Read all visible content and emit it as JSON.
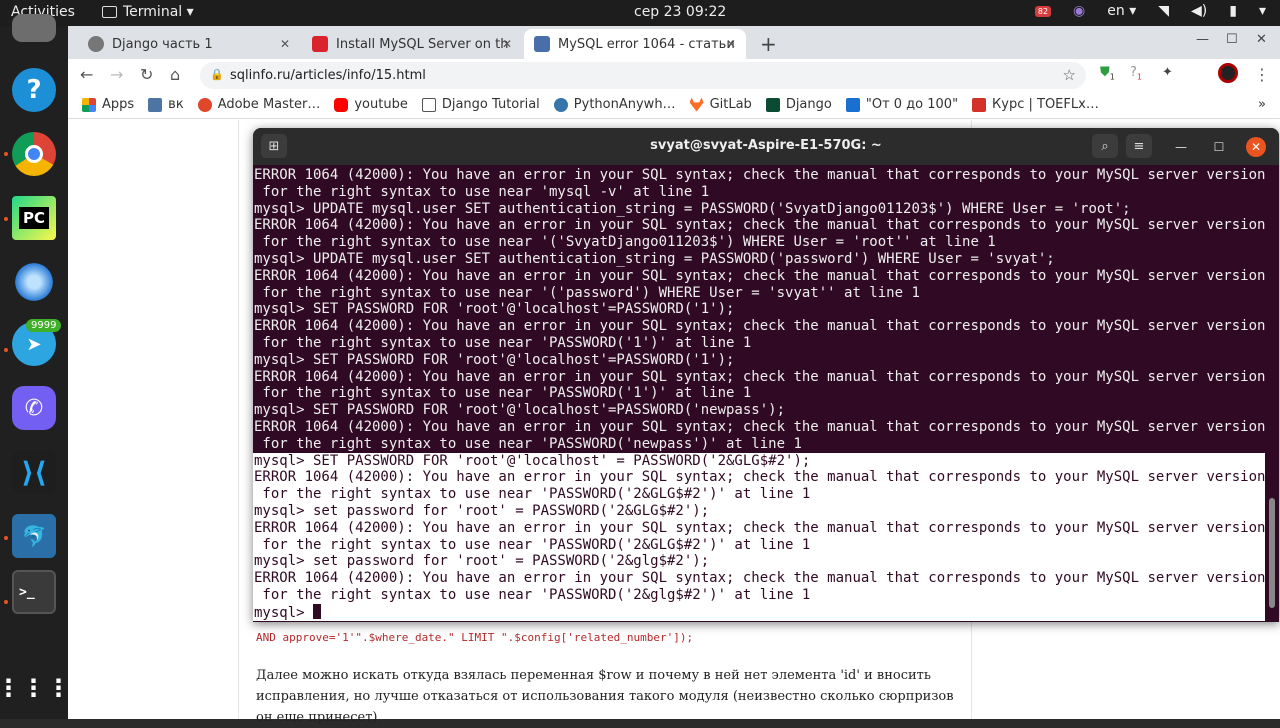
{
  "topbar": {
    "activities": "Activities",
    "app_menu": "Terminal ▾",
    "clock": "сер 23  09:22",
    "lang": "en ▾",
    "notif_count": "82"
  },
  "dock": {
    "telegram_badge": "9999",
    "pycharm_label": "PC",
    "help_label": "?"
  },
  "browser": {
    "tabs": [
      {
        "label": "Django часть 1"
      },
      {
        "label": "Install MySQL Server on th"
      },
      {
        "label": "MySQL error 1064 - статьи"
      }
    ],
    "url": "sqlinfo.ru/articles/info/15.html",
    "bookmarks": [
      "Apps",
      "вк",
      "Adobe Master…",
      "youtube",
      "Django Tutorial",
      "PythonAnywh…",
      "GitLab",
      "Django",
      "\"От 0 до 100\"",
      "Курс | TOEFLx…"
    ],
    "ext_badge_1": "1",
    "ext_badge_2": "1"
  },
  "page": {
    "code_line": "AND approve='1'\".$where_date.\" LIMIT \".$config['related_number']);",
    "paragraph": "Далее можно искать откуда взялась переменная $row и почему в ней нет элемента 'id' и вносить исправления, но лучше отказаться от использования такого модуля (неизвестно сколько сюрпризов он еще принесет)."
  },
  "terminal": {
    "title": "svyat@svyat-Aspire-E1-570G: ~",
    "lines": [
      "ERROR 1064 (42000): You have an error in your SQL syntax; check the manual that corresponds to your MySQL server version",
      " for the right syntax to use near 'mysql -v' at line 1",
      "mysql> UPDATE mysql.user SET authentication_string = PASSWORD('SvyatDjango011203$') WHERE User = 'root';",
      "ERROR 1064 (42000): You have an error in your SQL syntax; check the manual that corresponds to your MySQL server version",
      " for the right syntax to use near '('SvyatDjango011203$') WHERE User = 'root'' at line 1",
      "mysql> UPDATE mysql.user SET authentication_string = PASSWORD('password') WHERE User = 'svyat';",
      "ERROR 1064 (42000): You have an error in your SQL syntax; check the manual that corresponds to your MySQL server version",
      " for the right syntax to use near '('password') WHERE User = 'svyat'' at line 1",
      "mysql> SET PASSWORD FOR 'root'@'localhost'=PASSWORD('1');",
      "ERROR 1064 (42000): You have an error in your SQL syntax; check the manual that corresponds to your MySQL server version",
      " for the right syntax to use near 'PASSWORD('1')' at line 1",
      "mysql> SET PASSWORD FOR 'root'@'localhost'=PASSWORD('1');",
      "ERROR 1064 (42000): You have an error in your SQL syntax; check the manual that corresponds to your MySQL server version",
      " for the right syntax to use near 'PASSWORD('1')' at line 1",
      "mysql> SET PASSWORD FOR 'root'@'localhost'=PASSWORD('newpass');",
      "ERROR 1064 (42000): You have an error in your SQL syntax; check the manual that corresponds to your MySQL server version",
      " for the right syntax to use near 'PASSWORD('newpass')' at line 1",
      "mysql> SET PASSWORD FOR 'root'@'localhost' = PASSWORD('2&GLG$#2');",
      "ERROR 1064 (42000): You have an error in your SQL syntax; check the manual that corresponds to your MySQL server version",
      " for the right syntax to use near 'PASSWORD('2&GLG$#2')' at line 1",
      "mysql> set password for 'root' = PASSWORD('2&GLG$#2');",
      "ERROR 1064 (42000): You have an error in your SQL syntax; check the manual that corresponds to your MySQL server version",
      " for the right syntax to use near 'PASSWORD('2&GLG$#2')' at line 1",
      "mysql> set password for 'root' = PASSWORD('2&glg$#2');",
      "ERROR 1064 (42000): You have an error in your SQL syntax; check the manual that corresponds to your MySQL server version",
      " for the right syntax to use near 'PASSWORD('2&glg$#2')' at line 1",
      "mysql> "
    ]
  },
  "colors": {
    "terminal_bg": "#300a24",
    "ubuntu_orange": "#e95420"
  }
}
